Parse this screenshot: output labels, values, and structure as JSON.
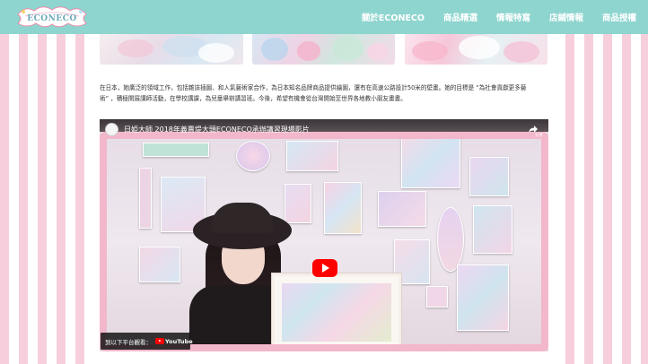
{
  "header": {
    "logo_text": "ECONECO",
    "nav": [
      {
        "label": "關於ECONECO"
      },
      {
        "label": "商品精選"
      },
      {
        "label": "情報特寫"
      },
      {
        "label": "店鋪情報"
      },
      {
        "label": "商品授權"
      }
    ]
  },
  "article": {
    "paragraph_line1": "在日本，她廣泛的領域工作，包括雜誌插圖、和人氣藝術家合作，為日本知名品牌商品提供繪圖，還有在高速公路設計50米的壁畫。她的目標是 “為社會貢獻更多藝",
    "paragraph_line2": "術” ，積極開展講師活動，在學校講課，為兒童舉辦講習班。今後，希望有機會從台灣開始至世界各地教小朋友畫畫。"
  },
  "video": {
    "title": "日姫大師 2018年義賣堤大頭ECONECO承辦講習現場影片",
    "share_label": "分享",
    "watch_on_label": "到以下平台觀看：",
    "youtube_label": "YouTube"
  },
  "colors": {
    "header_bg": "#8ed5cf",
    "stripe_pink": "#f7cfdc",
    "frame_pink": "#f3b7cb",
    "youtube_red": "#ff0000"
  }
}
